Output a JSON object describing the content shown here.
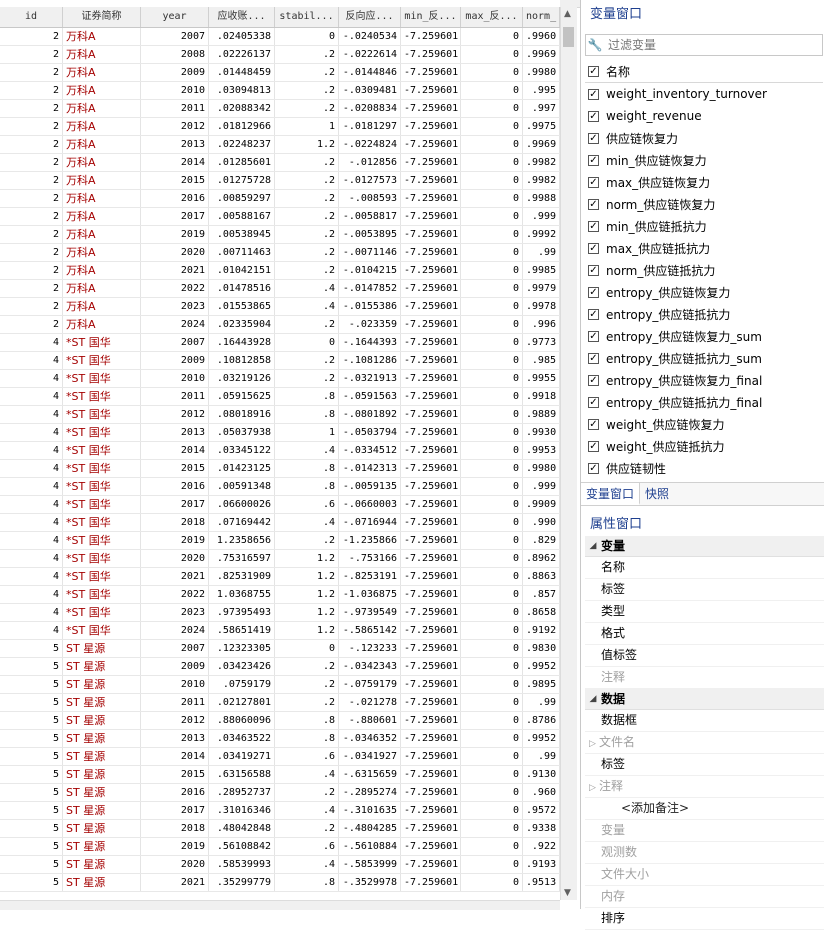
{
  "grid": {
    "headers": [
      "id",
      "证券简称",
      "year",
      "应收账...",
      "stabil...",
      "反向应...",
      "min_反...",
      "max_反...",
      "norm_"
    ],
    "rows": [
      [
        "2",
        "万科A",
        "2007",
        ".02405338",
        "0",
        "-.0240534",
        "-7.259601",
        "0",
        ".9960"
      ],
      [
        "2",
        "万科A",
        "2008",
        ".02226137",
        ".2",
        "-.0222614",
        "-7.259601",
        "0",
        ".9969"
      ],
      [
        "2",
        "万科A",
        "2009",
        ".01448459",
        ".2",
        "-.0144846",
        "-7.259601",
        "0",
        ".9980"
      ],
      [
        "2",
        "万科A",
        "2010",
        ".03094813",
        ".2",
        "-.0309481",
        "-7.259601",
        "0",
        ".995"
      ],
      [
        "2",
        "万科A",
        "2011",
        ".02088342",
        ".2",
        "-.0208834",
        "-7.259601",
        "0",
        ".997"
      ],
      [
        "2",
        "万科A",
        "2012",
        ".01812966",
        "1",
        "-.0181297",
        "-7.259601",
        "0",
        ".9975"
      ],
      [
        "2",
        "万科A",
        "2013",
        ".02248237",
        "1.2",
        "-.0224824",
        "-7.259601",
        "0",
        ".9969"
      ],
      [
        "2",
        "万科A",
        "2014",
        ".01285601",
        ".2",
        "-.012856",
        "-7.259601",
        "0",
        ".9982"
      ],
      [
        "2",
        "万科A",
        "2015",
        ".01275728",
        ".2",
        "-.0127573",
        "-7.259601",
        "0",
        ".9982"
      ],
      [
        "2",
        "万科A",
        "2016",
        ".00859297",
        ".2",
        "-.008593",
        "-7.259601",
        "0",
        ".9988"
      ],
      [
        "2",
        "万科A",
        "2017",
        ".00588167",
        ".2",
        "-.0058817",
        "-7.259601",
        "0",
        ".999"
      ],
      [
        "2",
        "万科A",
        "2019",
        ".00538945",
        ".2",
        "-.0053895",
        "-7.259601",
        "0",
        ".9992"
      ],
      [
        "2",
        "万科A",
        "2020",
        ".00711463",
        ".2",
        "-.0071146",
        "-7.259601",
        "0",
        ".99"
      ],
      [
        "2",
        "万科A",
        "2021",
        ".01042151",
        ".2",
        "-.0104215",
        "-7.259601",
        "0",
        ".9985"
      ],
      [
        "2",
        "万科A",
        "2022",
        ".01478516",
        ".4",
        "-.0147852",
        "-7.259601",
        "0",
        ".9979"
      ],
      [
        "2",
        "万科A",
        "2023",
        ".01553865",
        ".4",
        "-.0155386",
        "-7.259601",
        "0",
        ".9978"
      ],
      [
        "2",
        "万科A",
        "2024",
        ".02335904",
        ".2",
        "-.023359",
        "-7.259601",
        "0",
        ".996"
      ],
      [
        "4",
        "*ST 国华",
        "2007",
        ".16443928",
        "0",
        "-.1644393",
        "-7.259601",
        "0",
        ".9773"
      ],
      [
        "4",
        "*ST 国华",
        "2009",
        ".10812858",
        ".2",
        "-.1081286",
        "-7.259601",
        "0",
        ".985"
      ],
      [
        "4",
        "*ST 国华",
        "2010",
        ".03219126",
        ".2",
        "-.0321913",
        "-7.259601",
        "0",
        ".9955"
      ],
      [
        "4",
        "*ST 国华",
        "2011",
        ".05915625",
        ".8",
        "-.0591563",
        "-7.259601",
        "0",
        ".9918"
      ],
      [
        "4",
        "*ST 国华",
        "2012",
        ".08018916",
        ".8",
        "-.0801892",
        "-7.259601",
        "0",
        ".9889"
      ],
      [
        "4",
        "*ST 国华",
        "2013",
        ".05037938",
        "1",
        "-.0503794",
        "-7.259601",
        "0",
        ".9930"
      ],
      [
        "4",
        "*ST 国华",
        "2014",
        ".03345122",
        ".4",
        "-.0334512",
        "-7.259601",
        "0",
        ".9953"
      ],
      [
        "4",
        "*ST 国华",
        "2015",
        ".01423125",
        ".8",
        "-.0142313",
        "-7.259601",
        "0",
        ".9980"
      ],
      [
        "4",
        "*ST 国华",
        "2016",
        ".00591348",
        ".8",
        "-.0059135",
        "-7.259601",
        "0",
        ".999"
      ],
      [
        "4",
        "*ST 国华",
        "2017",
        ".06600026",
        ".6",
        "-.0660003",
        "-7.259601",
        "0",
        ".9909"
      ],
      [
        "4",
        "*ST 国华",
        "2018",
        ".07169442",
        ".4",
        "-.0716944",
        "-7.259601",
        "0",
        ".990"
      ],
      [
        "4",
        "*ST 国华",
        "2019",
        "1.2358656",
        ".2",
        "-1.235866",
        "-7.259601",
        "0",
        ".829"
      ],
      [
        "4",
        "*ST 国华",
        "2020",
        ".75316597",
        "1.2",
        "-.753166",
        "-7.259601",
        "0",
        ".8962"
      ],
      [
        "4",
        "*ST 国华",
        "2021",
        ".82531909",
        "1.2",
        "-.8253191",
        "-7.259601",
        "0",
        ".8863"
      ],
      [
        "4",
        "*ST 国华",
        "2022",
        "1.0368755",
        "1.2",
        "-1.036875",
        "-7.259601",
        "0",
        ".857"
      ],
      [
        "4",
        "*ST 国华",
        "2023",
        ".97395493",
        "1.2",
        "-.9739549",
        "-7.259601",
        "0",
        ".8658"
      ],
      [
        "4",
        "*ST 国华",
        "2024",
        ".58651419",
        "1.2",
        "-.5865142",
        "-7.259601",
        "0",
        ".9192"
      ],
      [
        "5",
        "ST 星源",
        "2007",
        ".12323305",
        "0",
        "-.123233",
        "-7.259601",
        "0",
        ".9830"
      ],
      [
        "5",
        "ST 星源",
        "2009",
        ".03423426",
        ".2",
        "-.0342343",
        "-7.259601",
        "0",
        ".9952"
      ],
      [
        "5",
        "ST 星源",
        "2010",
        ".0759179",
        ".2",
        "-.0759179",
        "-7.259601",
        "0",
        ".9895"
      ],
      [
        "5",
        "ST 星源",
        "2011",
        ".02127801",
        ".2",
        "-.021278",
        "-7.259601",
        "0",
        ".99"
      ],
      [
        "5",
        "ST 星源",
        "2012",
        ".88060096",
        ".8",
        "-.880601",
        "-7.259601",
        "0",
        ".8786"
      ],
      [
        "5",
        "ST 星源",
        "2013",
        ".03463522",
        ".8",
        "-.0346352",
        "-7.259601",
        "0",
        ".9952"
      ],
      [
        "5",
        "ST 星源",
        "2014",
        ".03419271",
        ".6",
        "-.0341927",
        "-7.259601",
        "0",
        ".99"
      ],
      [
        "5",
        "ST 星源",
        "2015",
        ".63156588",
        ".4",
        "-.6315659",
        "-7.259601",
        "0",
        ".9130"
      ],
      [
        "5",
        "ST 星源",
        "2016",
        ".28952737",
        ".2",
        "-.2895274",
        "-7.259601",
        "0",
        ".960"
      ],
      [
        "5",
        "ST 星源",
        "2017",
        ".31016346",
        ".4",
        "-.3101635",
        "-7.259601",
        "0",
        ".9572"
      ],
      [
        "5",
        "ST 星源",
        "2018",
        ".48042848",
        ".2",
        "-.4804285",
        "-7.259601",
        "0",
        ".9338"
      ],
      [
        "5",
        "ST 星源",
        "2019",
        ".56108842",
        ".6",
        "-.5610884",
        "-7.259601",
        "0",
        ".922"
      ],
      [
        "5",
        "ST 星源",
        "2020",
        ".58539993",
        ".4",
        "-.5853999",
        "-7.259601",
        "0",
        ".9193"
      ],
      [
        "5",
        "ST 星源",
        "2021",
        ".35299779",
        ".8",
        "-.3529978",
        "-7.259601",
        "0",
        ".9513"
      ]
    ]
  },
  "variables_window": {
    "title": "变量窗口",
    "filter_placeholder": "过滤变量",
    "column_header": "名称",
    "items": [
      "weight_inventory_turnover",
      "weight_revenue",
      "供应链恢复力",
      "min_供应链恢复力",
      "max_供应链恢复力",
      "norm_供应链恢复力",
      "min_供应链抵抗力",
      "max_供应链抵抗力",
      "norm_供应链抵抗力",
      "entropy_供应链恢复力",
      "entropy_供应链抵抗力",
      "entropy_供应链恢复力_sum",
      "entropy_供应链抵抗力_sum",
      "entropy_供应链恢复力_final",
      "entropy_供应链抵抗力_final",
      "weight_供应链恢复力",
      "weight_供应链抵抗力",
      "供应链韧性"
    ],
    "tabs": [
      "变量窗口",
      "快照"
    ]
  },
  "properties_window": {
    "title": "属性窗口",
    "sections": [
      {
        "label": "变量",
        "rows": [
          {
            "label": "名称",
            "gray": false
          },
          {
            "label": "标签",
            "gray": false
          },
          {
            "label": "类型",
            "gray": false
          },
          {
            "label": "格式",
            "gray": false
          },
          {
            "label": "值标签",
            "gray": false
          },
          {
            "label": "注释",
            "gray": true
          }
        ]
      },
      {
        "label": "数据",
        "rows": [
          {
            "label": "数据框",
            "gray": false
          },
          {
            "label": "文件名",
            "gray": true,
            "expander": true
          },
          {
            "label": "标签",
            "gray": false
          },
          {
            "label": "注释",
            "gray": true,
            "expander": true
          },
          {
            "label": "<添加备注>",
            "gray": false,
            "note": true
          },
          {
            "label": "变量",
            "gray": true
          },
          {
            "label": "观测数",
            "gray": true
          },
          {
            "label": "文件大小",
            "gray": true
          },
          {
            "label": "内存",
            "gray": true
          },
          {
            "label": "排序",
            "gray": false
          }
        ]
      }
    ]
  },
  "colors": {
    "accent": "#1e3f8f",
    "string_value": "#a40000"
  }
}
